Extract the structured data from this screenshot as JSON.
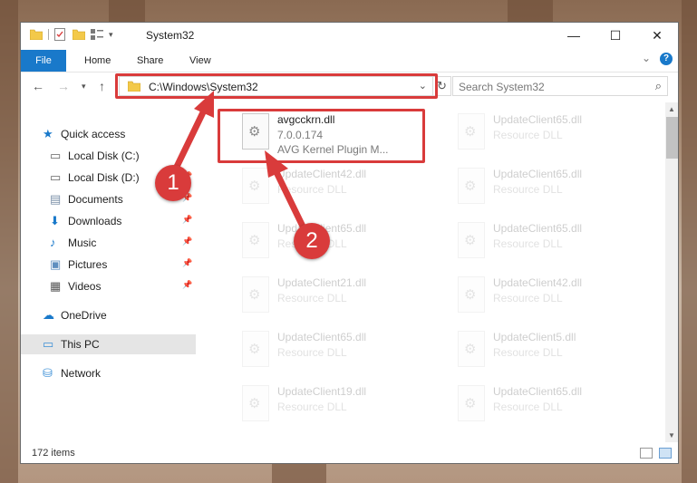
{
  "window": {
    "title": "System32"
  },
  "ribbon": {
    "tabs": [
      "File",
      "Home",
      "Share",
      "View"
    ]
  },
  "nav": {
    "address": "C:\\Windows\\System32",
    "search_placeholder": "Search System32"
  },
  "sidebar": {
    "items": [
      {
        "label": "Quick access",
        "icon": "star-icon",
        "pinned": false
      },
      {
        "label": "Local Disk (C:)",
        "icon": "drive-icon",
        "pinned": false
      },
      {
        "label": "Local Disk (D:)",
        "icon": "drive-icon",
        "pinned": true
      },
      {
        "label": "Documents",
        "icon": "documents-icon",
        "pinned": true
      },
      {
        "label": "Downloads",
        "icon": "download-icon",
        "pinned": true
      },
      {
        "label": "Music",
        "icon": "music-icon",
        "pinned": true
      },
      {
        "label": "Pictures",
        "icon": "pictures-icon",
        "pinned": true
      },
      {
        "label": "Videos",
        "icon": "videos-icon",
        "pinned": true
      },
      {
        "label": "OneDrive",
        "icon": "cloud-icon",
        "pinned": false
      },
      {
        "label": "This PC",
        "icon": "computer-icon",
        "pinned": false,
        "selected": true
      },
      {
        "label": "Network",
        "icon": "network-icon",
        "pinned": false
      }
    ]
  },
  "files": [
    {
      "name": "avgcckrn.dll",
      "type": "7.0.0.174",
      "desc": "AVG Kernel Plugin M...",
      "highlight": true
    },
    {
      "name": "UpdateClient65.dll",
      "type": "Resource DLL"
    },
    {
      "name": "UpdateClient42.dll",
      "type": "Resource DLL"
    },
    {
      "name": "UpdateClient65.dll",
      "type": "Resource DLL"
    },
    {
      "name": "UpdateClient65.dll",
      "type": "Resource DLL"
    },
    {
      "name": "UpdateClient65.dll",
      "type": "Resource DLL"
    },
    {
      "name": "UpdateClient21.dll",
      "type": "Resource DLL"
    },
    {
      "name": "UpdateClient42.dll",
      "type": "Resource DLL"
    },
    {
      "name": "UpdateClient65.dll",
      "type": "Resource DLL"
    },
    {
      "name": "UpdateClient5.dll",
      "type": "Resource DLL"
    },
    {
      "name": "UpdateClient19.dll",
      "type": "Resource DLL"
    },
    {
      "name": "UpdateClient65.dll",
      "type": "Resource DLL"
    }
  ],
  "status": {
    "item_count": "172 items"
  },
  "annotations": {
    "badge1": "1",
    "badge2": "2"
  },
  "colors": {
    "accent": "#1979ca",
    "annotation_red": "#d93b3b"
  }
}
